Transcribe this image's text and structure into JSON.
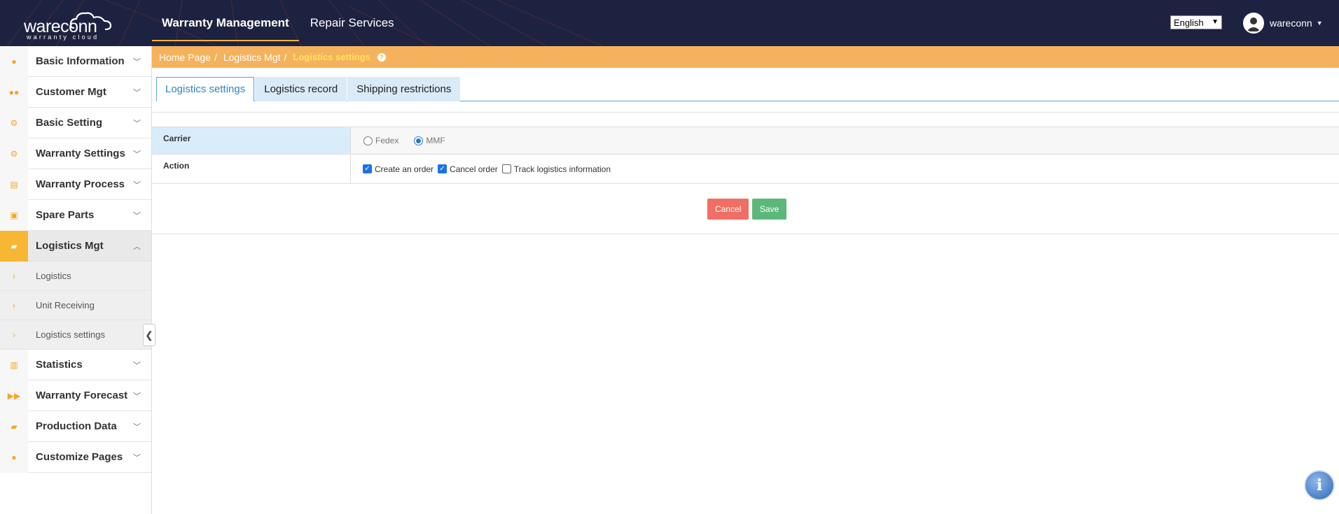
{
  "header": {
    "logo_text": "wareconn",
    "logo_tagline": "warranty cloud",
    "nav": [
      {
        "label": "Warranty Management",
        "active": true
      },
      {
        "label": "Repair Services",
        "active": false
      }
    ],
    "language": "English",
    "user": "wareconn"
  },
  "sidebar": {
    "items": [
      {
        "label": "Basic Information",
        "icon": "user-icon"
      },
      {
        "label": "Customer Mgt",
        "icon": "users-icon"
      },
      {
        "label": "Basic Setting",
        "icon": "cogs-icon"
      },
      {
        "label": "Warranty Settings",
        "icon": "gear-icon"
      },
      {
        "label": "Warranty Process",
        "icon": "document-icon"
      },
      {
        "label": "Spare Parts",
        "icon": "briefcase-icon"
      },
      {
        "label": "Logistics Mgt",
        "icon": "truck-icon"
      },
      {
        "label": "Statistics",
        "icon": "bar-chart-icon"
      },
      {
        "label": "Warranty Forecast",
        "icon": "fast-forward-icon"
      },
      {
        "label": "Production Data",
        "icon": "truck-icon"
      },
      {
        "label": "Customize Pages",
        "icon": "user-icon"
      }
    ],
    "sub_items": [
      "Logistics",
      "Unit Receiving",
      "Logistics settings"
    ]
  },
  "breadcrumb": {
    "home": "Home Page",
    "parent": "Logistics Mgt",
    "current": "Logistics settings",
    "help": "?"
  },
  "tabs": [
    "Logistics settings",
    "Logistics record",
    "Shipping restrictions"
  ],
  "form": {
    "carrier_label": "Carrier",
    "carrier_options": [
      "Fedex",
      "MMF"
    ],
    "carrier_selected": "MMF",
    "action_label": "Action",
    "actions": [
      {
        "label": "Create an order",
        "checked": true
      },
      {
        "label": "Cancel order",
        "checked": true
      },
      {
        "label": "Track logistics information",
        "checked": false
      }
    ]
  },
  "buttons": {
    "cancel": "Cancel",
    "save": "Save"
  },
  "colors": {
    "header_bg": "#1d2240",
    "accent": "#f6a623",
    "breadcrumb_bg": "#f5b25c",
    "cancel": "#f06e64",
    "save": "#5cb87a"
  }
}
